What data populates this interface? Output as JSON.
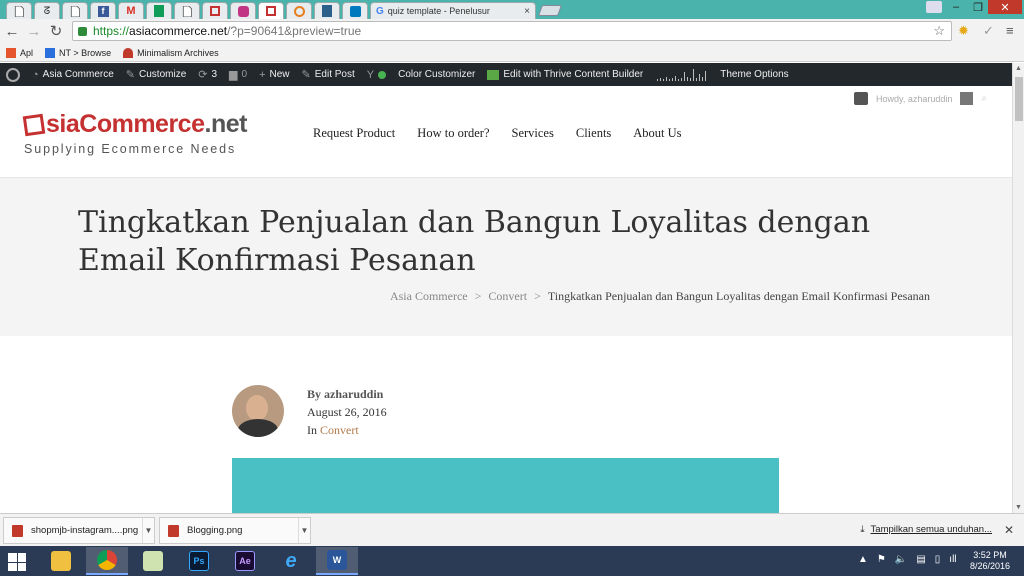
{
  "browser": {
    "tabs": [
      {
        "icon": "page-icon"
      },
      {
        "icon": "swirl-icon"
      },
      {
        "icon": "page-icon"
      },
      {
        "icon": "facebook-icon"
      },
      {
        "icon": "gmail-icon"
      },
      {
        "icon": "sheets-icon"
      },
      {
        "icon": "page-icon"
      },
      {
        "icon": "box-icon"
      },
      {
        "icon": "instagram-icon"
      },
      {
        "icon": "box-icon"
      },
      {
        "icon": "blocked-icon"
      },
      {
        "icon": "slash-icon"
      },
      {
        "icon": "trello-icon"
      },
      {
        "icon": "google-icon",
        "title": "quiz template - Penelusur",
        "close": "×"
      }
    ],
    "window_controls": {
      "minimize": "–",
      "restore": "❐",
      "close": "✕"
    },
    "address": {
      "scheme": "https://",
      "host": "asiacommerce.net",
      "path": "/?p=90641&preview=true"
    },
    "bookmarks": [
      {
        "icon": "apps-icon",
        "label": "Apl",
        "color": "#e6542e"
      },
      {
        "icon": "nt-icon",
        "label": "NT > Browse",
        "color": "#2a6fdb"
      },
      {
        "icon": "mushroom-icon",
        "label": "Minimalism Archives",
        "color": "#c0392b"
      }
    ]
  },
  "admin_bar": {
    "items": [
      {
        "name": "wp-logo",
        "label": ""
      },
      {
        "name": "site-name",
        "label": "Asia Commerce"
      },
      {
        "name": "customize",
        "label": "Customize"
      },
      {
        "name": "updates",
        "label": "3"
      },
      {
        "name": "comments",
        "label": "0"
      },
      {
        "name": "new",
        "label": "New"
      },
      {
        "name": "edit-post",
        "label": "Edit Post"
      },
      {
        "name": "color-customizer",
        "label": "Color Customizer"
      },
      {
        "name": "thrive",
        "label": "Edit with Thrive Content Builder"
      },
      {
        "name": "theme-options",
        "label": "Theme Options"
      }
    ]
  },
  "site": {
    "logo_prefix": "sia",
    "logo_main": "Commerce",
    "logo_tld": ".net",
    "tagline": "Supplying Ecommerce Needs",
    "howdy": "Howdy, azharuddin",
    "nav": [
      "Request Product",
      "How to order?",
      "Services",
      "Clients",
      "About Us"
    ]
  },
  "post": {
    "title": "Tingkatkan Penjualan dan Bangun Loyalitas dengan Email Konfirmasi Pesanan",
    "breadcrumb": [
      "Asia Commerce",
      "Convert",
      "Tingkatkan Penjualan dan Bangun Loyalitas dengan Email Konfirmasi Pesanan"
    ],
    "breadcrumb_sep": ">",
    "author": "By azharuddin",
    "date": "August 26, 2016",
    "category_prefix": "In",
    "category": "Convert",
    "feature_color": "#4abfc4"
  },
  "downloads": {
    "files": [
      "shopmjb-instagram....png",
      "Blogging.png"
    ],
    "show_all": "Tampilkan semua unduhan...",
    "close": "✕"
  },
  "taskbar": {
    "apps": [
      {
        "name": "file-explorer",
        "label": ""
      },
      {
        "name": "chrome",
        "label": ""
      },
      {
        "name": "folder",
        "label": ""
      },
      {
        "name": "photoshop",
        "label": "Ps"
      },
      {
        "name": "after-effects",
        "label": "Ae"
      },
      {
        "name": "internet-explorer",
        "label": "e"
      },
      {
        "name": "word",
        "label": "W"
      }
    ],
    "time": "3:52 PM",
    "date": "8/26/2016"
  }
}
